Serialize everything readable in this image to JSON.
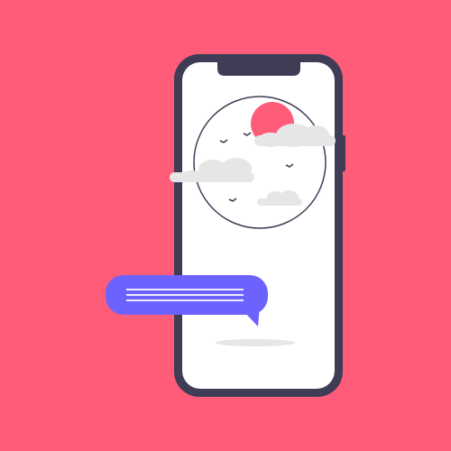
{
  "colors": {
    "background": "#ff5c7a",
    "phone_frame": "#3f3d56",
    "phone_screen": "#ffffff",
    "sun": "#ff5c7a",
    "cloud": "#e6e6e6",
    "bird": "#3f3d56",
    "chat_bubble": "#6c63ff",
    "chat_lines": "#ffffff",
    "shadow": "#e6e6e6"
  },
  "icons": {
    "phone": "smartphone-icon",
    "sun": "sun-icon",
    "cloud": "cloud-icon",
    "bird": "bird-icon",
    "chat": "chat-bubble-icon"
  }
}
